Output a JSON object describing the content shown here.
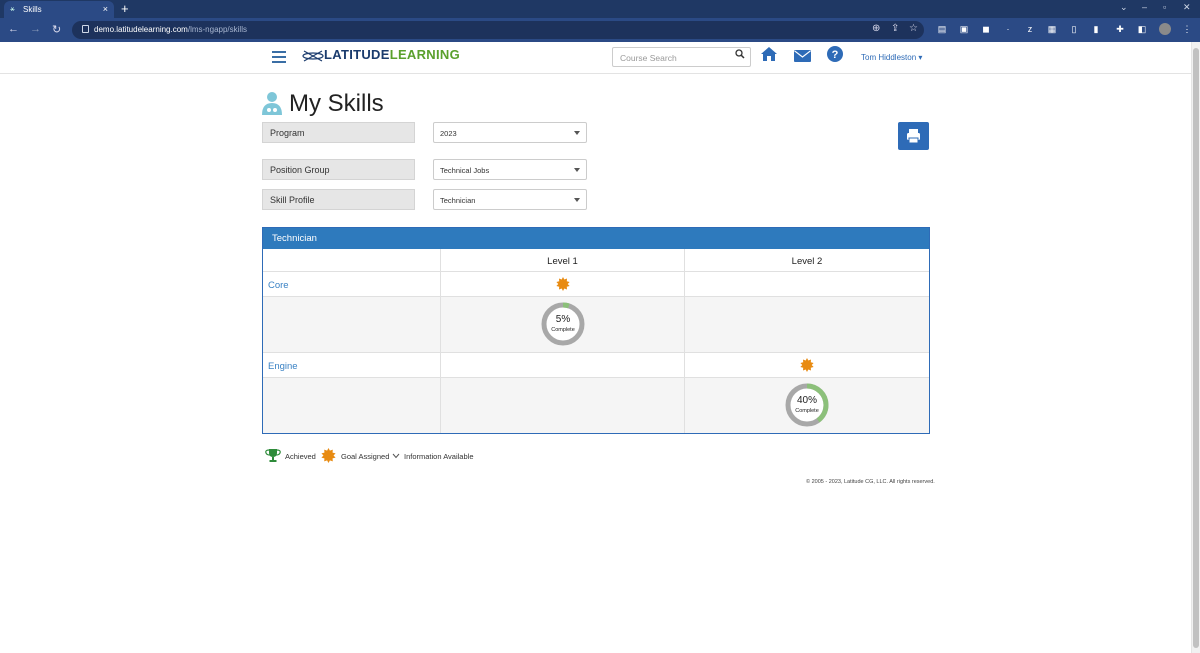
{
  "browser": {
    "tab_title": "Skills",
    "tab_close": "×",
    "new_tab": "+",
    "url_host": "demo.latitudelearning.com",
    "url_path": "/lms-ngapp/skills"
  },
  "header": {
    "logo_part1": "LATITUDE",
    "logo_part2": "LEARNING",
    "search_placeholder": "Course Search",
    "user_name": "Tom Hiddleston ▾",
    "accent_color": "#2e6bb7"
  },
  "page": {
    "title": "My Skills"
  },
  "filters": [
    {
      "label": "Program",
      "value": "2023"
    },
    {
      "label": "Position Group",
      "value": "Technical Jobs"
    },
    {
      "label": "Skill Profile",
      "value": "Technician"
    }
  ],
  "skills_table": {
    "heading": "Technician",
    "columns": [
      "Level 1",
      "Level 2"
    ],
    "rows": [
      {
        "name": "Core",
        "goal_level": "Level 1",
        "progress_percent": "5%",
        "progress_label": "Complete",
        "progress_value": 0.05
      },
      {
        "name": "Engine",
        "goal_level": "Level 2",
        "progress_percent": "40%",
        "progress_label": "Complete",
        "progress_value": 0.4
      }
    ]
  },
  "legend": {
    "achieved": "Achieved",
    "goal_assigned": "Goal Assigned",
    "info_available": "Information Available"
  },
  "footer": {
    "copyright": "© 2005 - 2023, Latitude CG, LLC. All rights reserved."
  }
}
